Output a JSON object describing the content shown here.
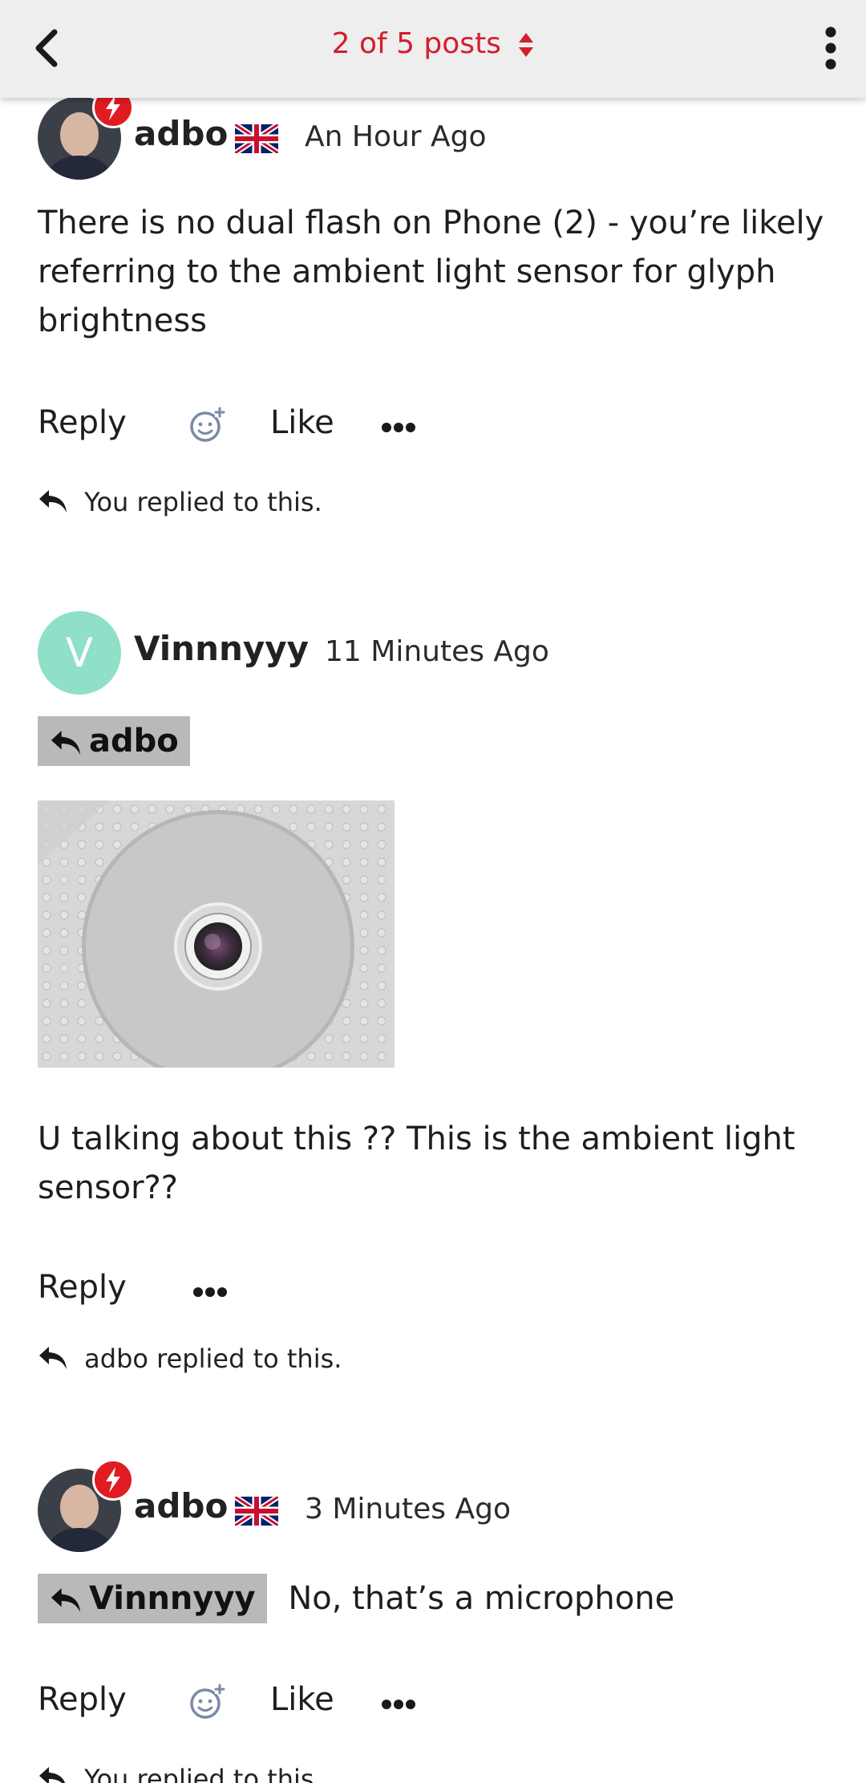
{
  "header": {
    "title": "2 of 5 posts",
    "back_icon": "chevron-left-icon",
    "sort_icon": "sort-icon",
    "menu_icon": "vertical-dots-icon"
  },
  "colors": {
    "accent": "#d21f2c",
    "badge": "#e11b22",
    "avatar_v": "#8fdfc9",
    "reply_tag_bg": "#b9b9b9",
    "emoji_icon": "#7a8aa8"
  },
  "posts": [
    {
      "username": "adbo",
      "timestamp": "An Hour Ago",
      "body": "There is no dual flash on Phone (2) - you’re likely referring to the ambient light sensor for glyph brightness",
      "actions": {
        "reply": "Reply",
        "like": "Like"
      },
      "replied_note": "You replied to this."
    },
    {
      "username": "Vinnnyyy",
      "avatar_letter": "V",
      "timestamp": "11 Minutes Ago",
      "reply_to": "adbo",
      "body": "U talking about this ?? This is the ambient light sensor??",
      "actions": {
        "reply": "Reply"
      },
      "replied_note": "adbo replied to this."
    },
    {
      "username": "adbo",
      "timestamp": "3 Minutes Ago",
      "reply_to": "Vinnnyyy",
      "body": "No, that’s a microphone",
      "actions": {
        "reply": "Reply",
        "like": "Like"
      },
      "replied_note": "You replied to this."
    }
  ]
}
